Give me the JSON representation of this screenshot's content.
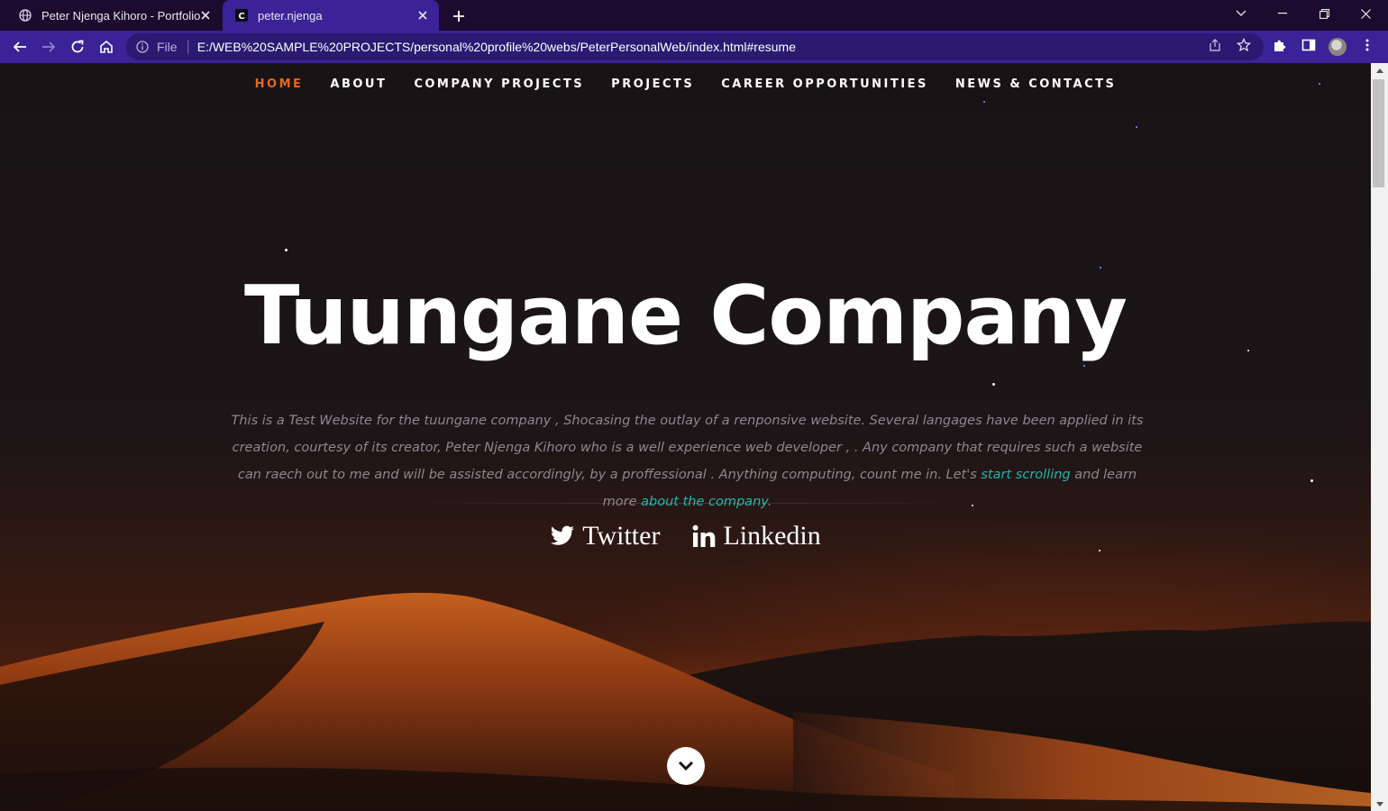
{
  "browser": {
    "tabs": [
      {
        "title": "Peter Njenga Kihoro - Portfolio",
        "active": false,
        "icon": "globe-icon"
      },
      {
        "title": "peter.njenga",
        "active": true,
        "icon": "c-logo-icon"
      }
    ],
    "address": {
      "scheme_label": "File",
      "url": "E:/WEB%20SAMPLE%20PROJECTS/personal%20profile%20webs/PeterPersonalWeb/index.html#resume"
    },
    "colors": {
      "tabbar": "#1c0b2e",
      "toolbar": "#3b2297"
    }
  },
  "site": {
    "nav": [
      {
        "label": "HOME",
        "active": true
      },
      {
        "label": "ABOUT",
        "active": false
      },
      {
        "label": "COMPANY PROJECTS",
        "active": false
      },
      {
        "label": "PROJECTS",
        "active": false
      },
      {
        "label": "CAREER OPPORTUNITIES",
        "active": false
      },
      {
        "label": "NEWS & CONTACTS",
        "active": false
      }
    ],
    "hero": {
      "title": "Tuungane Company",
      "description_text": "This is a Test Website for the tuungane company , Shocasing the outlay of a renponsive website. Several langages have been applied in its creation, courtesy of its creator, Peter Njenga Kihoro who is a well experience web developer , . Any company that requires such a website can raech out to me and will be assisted accordingly, by a proffessional . Anything computing, count me in. Let's",
      "link1": "start scrolling",
      "middle_text": " and learn more ",
      "link2": "about the company",
      "end_text": "."
    },
    "social": [
      {
        "label": "Twitter",
        "icon": "twitter-icon"
      },
      {
        "label": "Linkedin",
        "icon": "linkedin-icon"
      }
    ],
    "colors": {
      "accent": "#e06a1a",
      "link": "#1fb7ad"
    }
  }
}
